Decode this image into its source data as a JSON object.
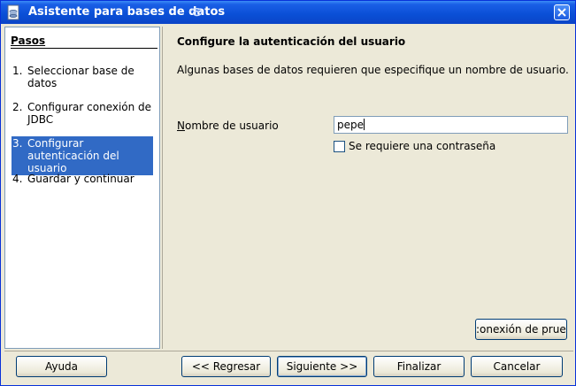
{
  "window": {
    "title": "Asistente para bases de datos"
  },
  "steps": {
    "heading": "Pasos",
    "items": [
      {
        "num": "1.",
        "label": "Seleccionar base de datos",
        "active": false
      },
      {
        "num": "2.",
        "label": "Configurar conexión de JDBC",
        "active": false
      },
      {
        "num": "3.",
        "label": "Configurar autenticación del usuario",
        "active": true
      },
      {
        "num": "4.",
        "label": "Guardar y continuar",
        "active": false
      }
    ]
  },
  "main": {
    "title": "Configure la autenticación del usuario",
    "description": "Algunas bases de datos requieren que especifique un nombre de usuario.",
    "user_label_first": "N",
    "user_label_rest": "ombre de usuario",
    "user_value": "pepe",
    "password_required_label": "Se requiere una contraseña",
    "password_required_checked": false,
    "test_connection_label": ":onexión de prueb"
  },
  "buttons": {
    "help": "Ayuda",
    "back": "<< Regresar",
    "next": "Siguiente >>",
    "finish": "Finalizar",
    "cancel": "Cancelar"
  }
}
